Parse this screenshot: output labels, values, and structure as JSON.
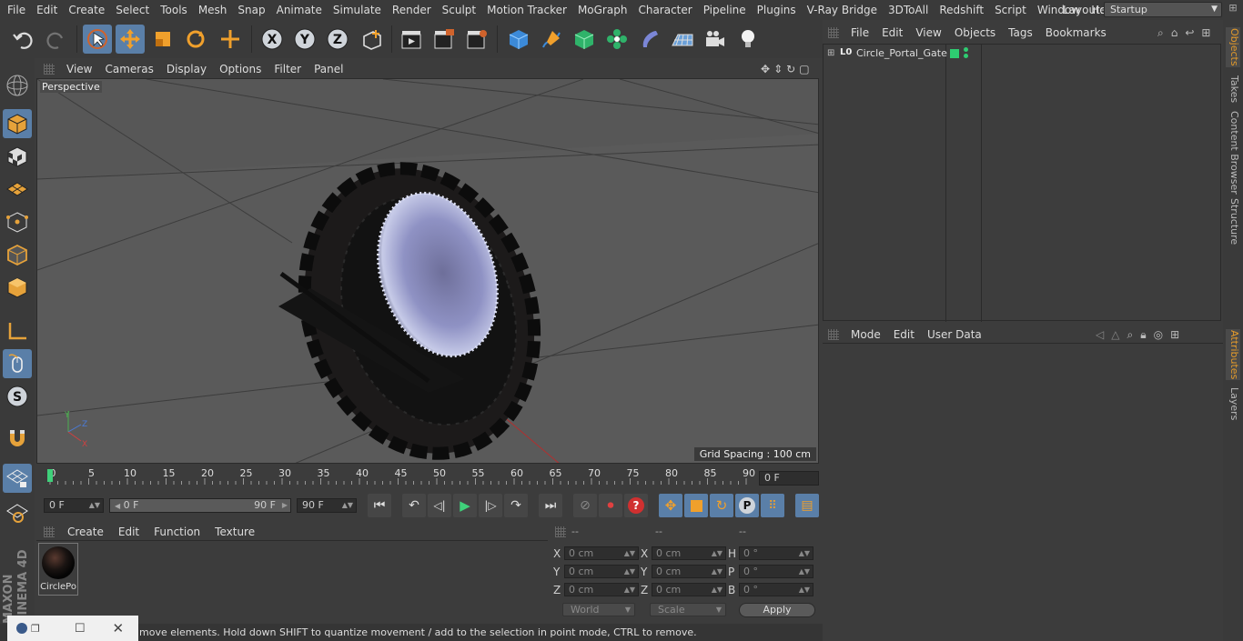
{
  "menubar": {
    "items": [
      "File",
      "Edit",
      "Create",
      "Select",
      "Tools",
      "Mesh",
      "Snap",
      "Animate",
      "Simulate",
      "Render",
      "Sculpt",
      "Motion Tracker",
      "MoGraph",
      "Character",
      "Pipeline",
      "Plugins",
      "V-Ray Bridge",
      "3DToAll",
      "Redshift",
      "Script",
      "Window",
      "Help"
    ],
    "layout_label": "Layout:",
    "layout_value": "Startup"
  },
  "viewport": {
    "menu": [
      "View",
      "Cameras",
      "Display",
      "Options",
      "Filter",
      "Panel"
    ],
    "label": "Perspective",
    "grid_spacing": "Grid Spacing : 100 cm"
  },
  "timeline": {
    "ticks": [
      "0",
      "5",
      "10",
      "15",
      "20",
      "25",
      "30",
      "35",
      "40",
      "45",
      "50",
      "55",
      "60",
      "65",
      "70",
      "75",
      "80",
      "85",
      "90"
    ],
    "current_frame_field": "0 F"
  },
  "anim": {
    "start_field": "0 F",
    "range_start": "0 F",
    "range_end": "90 F",
    "end_field": "90 F"
  },
  "materials": {
    "menu": [
      "Create",
      "Edit",
      "Function",
      "Texture"
    ],
    "items": [
      {
        "name": "CirclePo"
      }
    ]
  },
  "coords": {
    "headers": [
      "--",
      "--",
      "--"
    ],
    "rows": [
      {
        "l1": "X",
        "v1": "0 cm",
        "l2": "X",
        "v2": "0 cm",
        "l3": "H",
        "v3": "0 °"
      },
      {
        "l1": "Y",
        "v1": "0 cm",
        "l2": "Y",
        "v2": "0 cm",
        "l3": "P",
        "v3": "0 °"
      },
      {
        "l1": "Z",
        "v1": "0 cm",
        "l2": "Z",
        "v2": "0 cm",
        "l3": "B",
        "v3": "0 °"
      }
    ],
    "world": "World",
    "scale": "Scale",
    "apply": "Apply"
  },
  "status": {
    "text": "move elements. Hold down SHIFT to quantize movement / add to the selection in point mode, CTRL to remove."
  },
  "objects": {
    "menu": [
      "File",
      "Edit",
      "View",
      "Objects",
      "Tags",
      "Bookmarks"
    ],
    "items": [
      {
        "name": "Circle_Portal_Gate",
        "badge": "L0"
      }
    ]
  },
  "attributes": {
    "menu": [
      "Mode",
      "Edit",
      "User Data"
    ]
  },
  "right_tabs": [
    "Objects",
    "Takes",
    "Content Browser",
    "Structure",
    "Attributes",
    "Layers"
  ],
  "branding": {
    "logo": "MAXON CINEMA 4D"
  },
  "colors": {
    "accent": "#5a7fa8",
    "highlight": "#e39a2b",
    "tag_green": "#2ecc71"
  }
}
